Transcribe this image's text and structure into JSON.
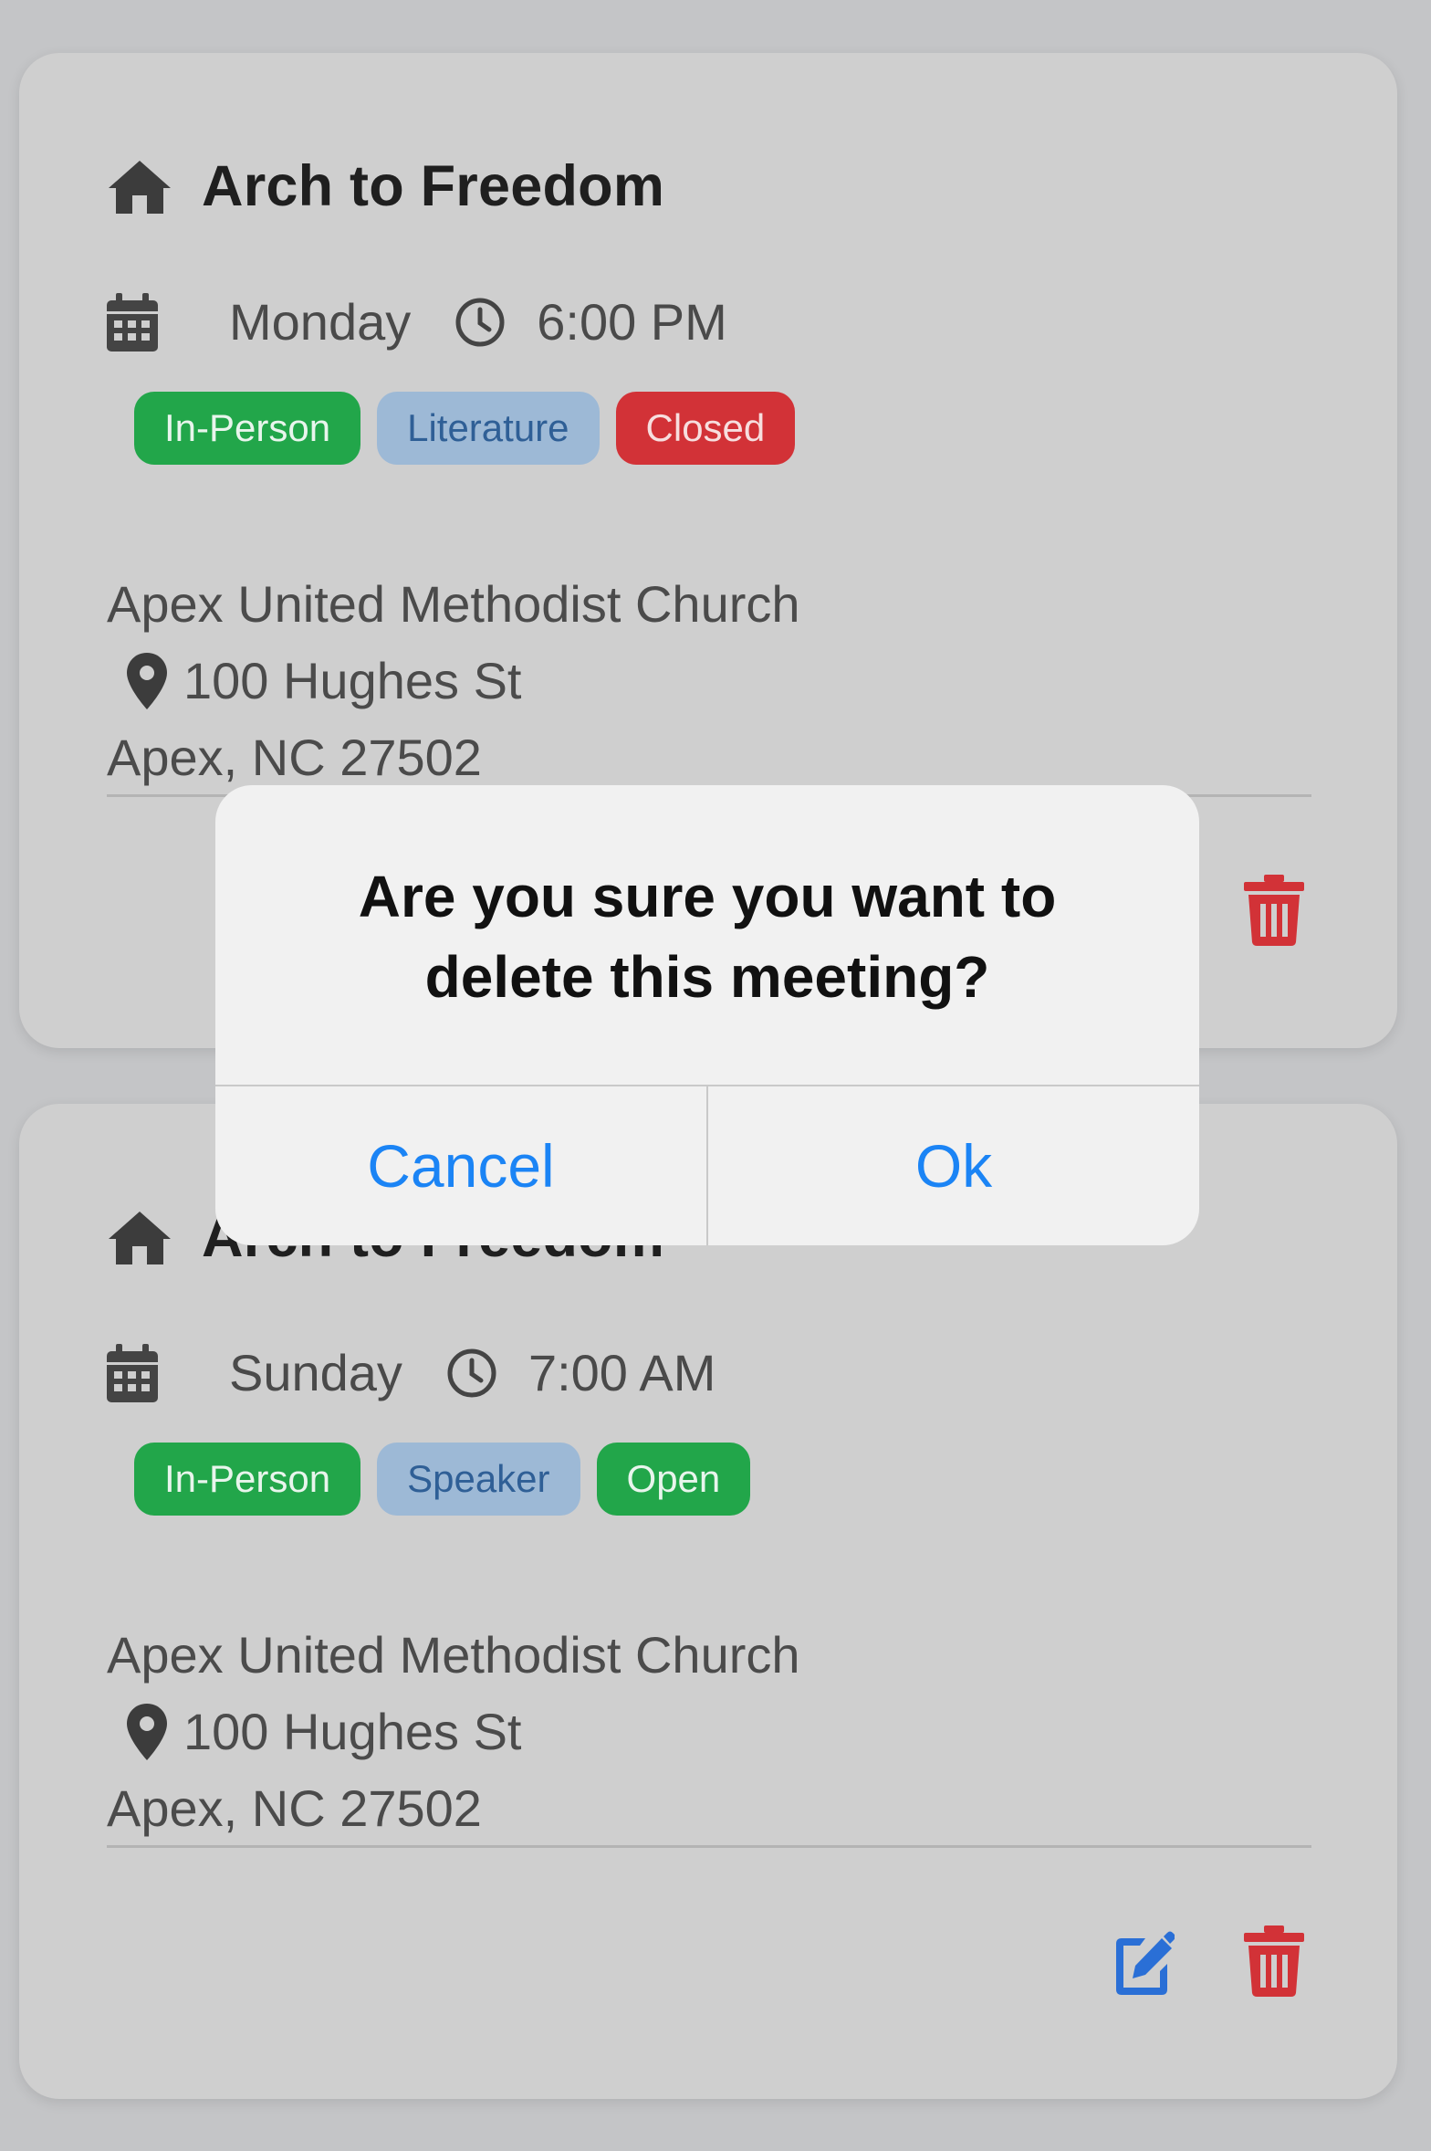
{
  "meetings": [
    {
      "name": "Arch to Freedom",
      "day": "Monday",
      "time": "6:00 PM",
      "tags": [
        {
          "label": "In-Person",
          "color": "#22a64a"
        },
        {
          "label": "Literature",
          "color": "#9db9d6"
        },
        {
          "label": "Closed",
          "color": "#d23237"
        }
      ],
      "location": "Apex United Methodist Church",
      "street": "100 Hughes St",
      "city": "Apex, NC 27502",
      "icons": [
        "home-icon",
        "calendar-icon",
        "clock-icon",
        "map-pin-icon",
        "trash-icon"
      ]
    },
    {
      "name": "Arch to Freedom",
      "day": "Sunday",
      "time": "7:00 AM",
      "tags": [
        {
          "label": "In-Person",
          "color": "#22a64a"
        },
        {
          "label": "Speaker",
          "color": "#9db9d6"
        },
        {
          "label": "Open",
          "color": "#22a64a"
        }
      ],
      "location": "Apex United Methodist Church",
      "street": "100 Hughes St",
      "city": "Apex, NC 27502",
      "icons": [
        "home-icon",
        "calendar-icon",
        "clock-icon",
        "map-pin-icon",
        "edit-icon",
        "trash-icon"
      ]
    }
  ],
  "alert": {
    "message": "Are you sure you want to delete this meeting?",
    "cancel_label": "Cancel",
    "ok_label": "Ok",
    "button_color": "#1b84f5"
  },
  "colors": {
    "edit_icon": "#2a6fd6",
    "trash_icon": "#d23237"
  }
}
